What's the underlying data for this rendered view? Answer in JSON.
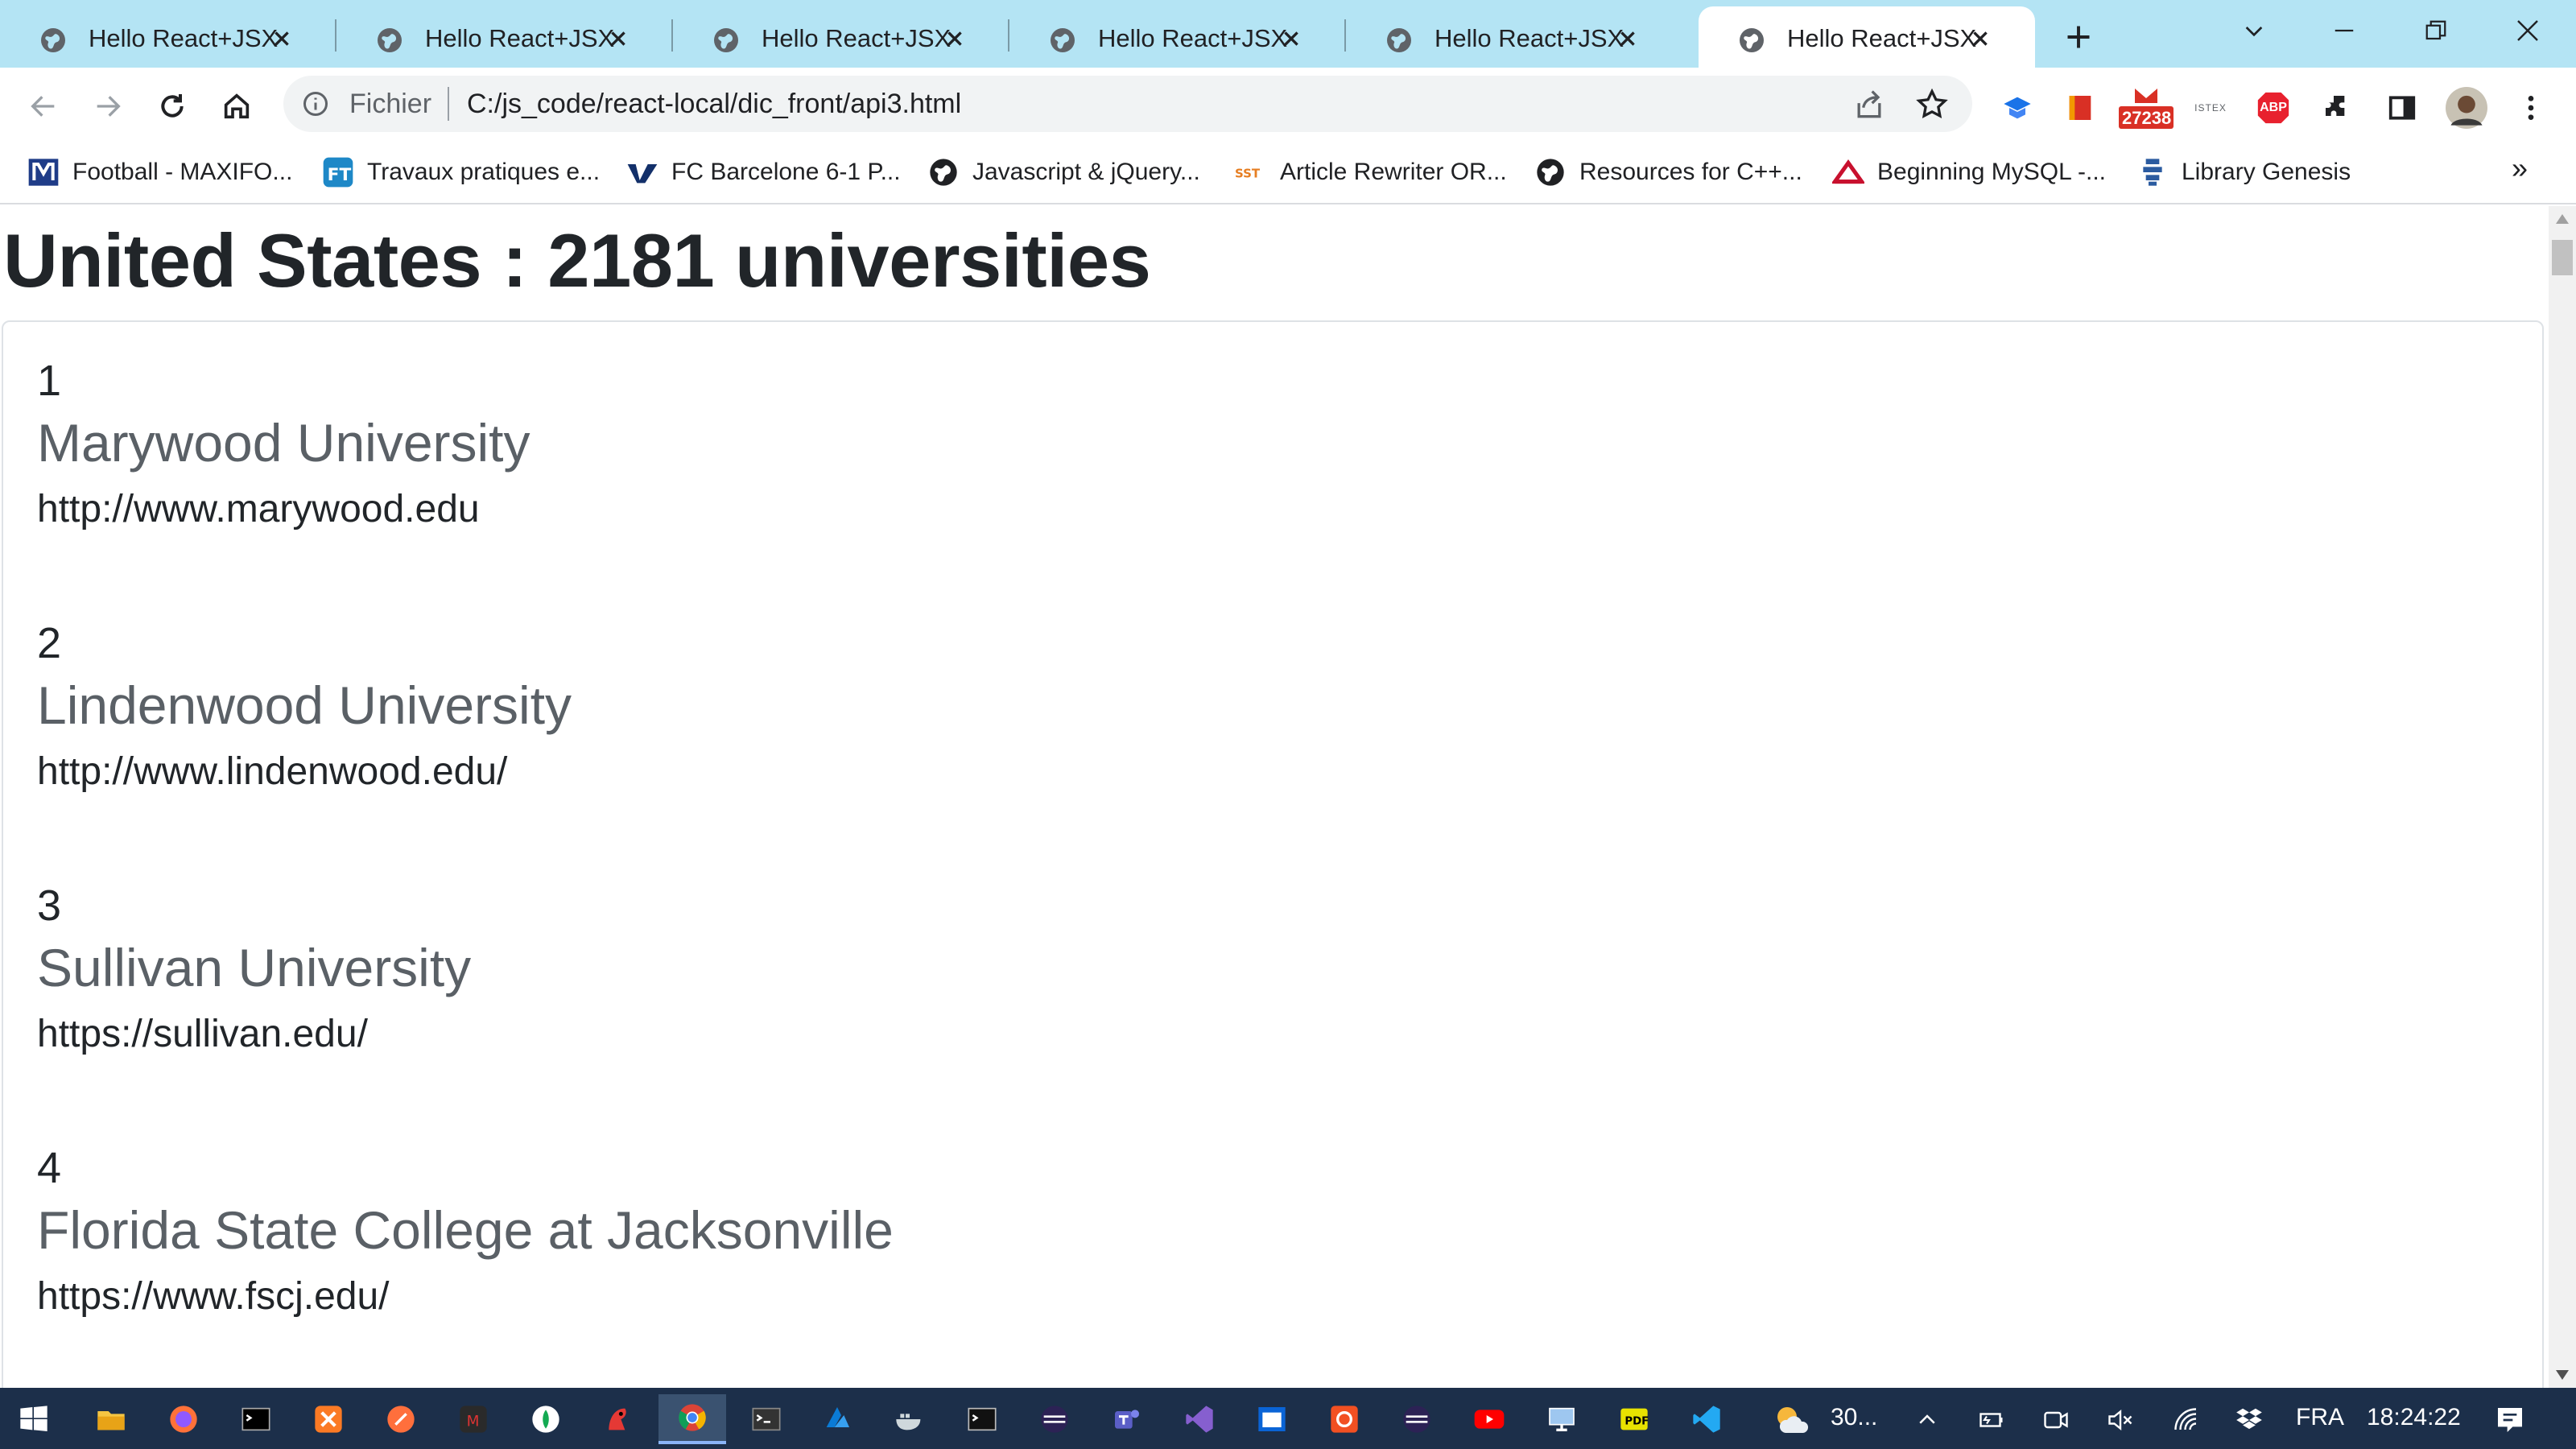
{
  "browser": {
    "tabs": [
      {
        "title": "Hello React+JSX",
        "active": false
      },
      {
        "title": "Hello React+JSX",
        "active": false
      },
      {
        "title": "Hello React+JSX",
        "active": false
      },
      {
        "title": "Hello React+JSX",
        "active": false
      },
      {
        "title": "Hello React+JSX",
        "active": false
      },
      {
        "title": "Hello React+JSX",
        "active": true
      }
    ],
    "scheme_label": "Fichier",
    "url": "C:/js_code/react-local/dic_front/api3.html",
    "extension_badge": "27238",
    "extension_small_label": "ISTEX",
    "extension_abp": "ABP",
    "bookmarks": [
      {
        "label": "Football - MAXIFO...",
        "icon": "maxifoot-icon"
      },
      {
        "label": "Travaux pratiques e...",
        "icon": "ft-icon"
      },
      {
        "label": "FC Barcelone 6-1 P...",
        "icon": "vavel-icon"
      },
      {
        "label": "Javascript & jQuery...",
        "icon": "globe-icon"
      },
      {
        "label": "Article Rewriter OR...",
        "icon": "sst-icon"
      },
      {
        "label": "Resources for C++...",
        "icon": "globe-icon"
      },
      {
        "label": "Beginning MySQL -...",
        "icon": "mysql-icon"
      },
      {
        "label": "Library Genesis",
        "icon": "libgen-icon"
      }
    ],
    "bookmarks_overflow": "»"
  },
  "page": {
    "title": "United States : 2181 universities",
    "universities": [
      {
        "index": "1",
        "name": "Marywood University",
        "url": "http://www.marywood.edu"
      },
      {
        "index": "2",
        "name": "Lindenwood University",
        "url": "http://www.lindenwood.edu/"
      },
      {
        "index": "3",
        "name": "Sullivan University",
        "url": "https://sullivan.edu/"
      },
      {
        "index": "4",
        "name": "Florida State College at Jacksonville",
        "url": "https://www.fscj.edu/"
      }
    ]
  },
  "taskbar": {
    "weather": "30...",
    "language": "FRA",
    "time": "18:24:22"
  },
  "colors": {
    "tabstrip": "#b4e4f4",
    "taskbar": "#1c2f4a",
    "name_text": "#5a6066"
  }
}
